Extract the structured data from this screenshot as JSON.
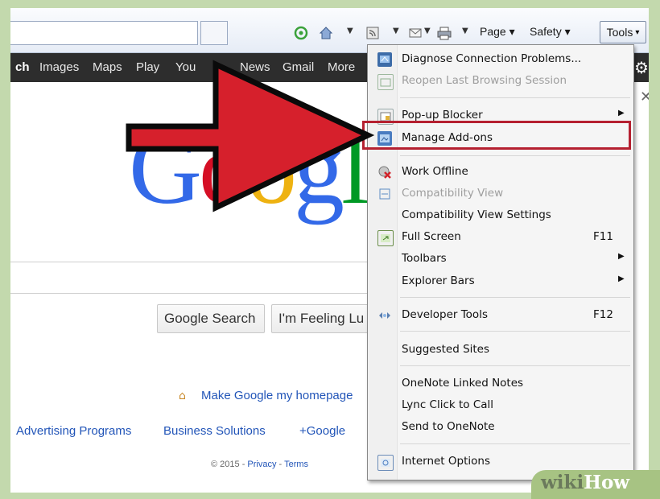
{
  "toolbar": {
    "page_label": "Page",
    "safety_label": "Safety",
    "tools_label": "Tools",
    "chevron": "»"
  },
  "google_bar": {
    "links": [
      "ch",
      "Images",
      "Maps",
      "Play",
      "You",
      "News",
      "Gmail",
      "More"
    ]
  },
  "google_logo_letters": [
    "G",
    "o",
    "o",
    "g",
    "l"
  ],
  "google_logo_colors": [
    "#3369e8",
    "#d50f25",
    "#eeb211",
    "#3369e8",
    "#009925"
  ],
  "buttons": {
    "search": "Google Search",
    "lucky": "I'm Feeling Lu"
  },
  "make_homepage": "Make Google my homepage",
  "footer_links": [
    "Advertising Programs",
    "Business Solutions",
    "+Google"
  ],
  "copyright": {
    "year": "© 2015 -",
    "privacy": "Privacy",
    "dash": "-",
    "terms": "Terms"
  },
  "menu": {
    "items": [
      {
        "label": "Diagnose Connection Problems...",
        "icon": "diagnose-icon",
        "disabled": false
      },
      {
        "label": "Reopen Last Browsing Session",
        "icon": "reopen-icon",
        "disabled": true
      },
      {
        "label": "Pop-up Blocker",
        "icon": "popup-icon",
        "submenu": true
      },
      {
        "label": "Manage Add-ons",
        "icon": "addons-icon",
        "highlighted": true
      },
      {
        "label": "Work Offline",
        "icon": "offline-icon"
      },
      {
        "label": "Compatibility View",
        "icon": "compat-icon",
        "disabled": true
      },
      {
        "label": "Compatibility View Settings"
      },
      {
        "label": "Full Screen",
        "icon": "fullscreen-icon",
        "shortcut": "F11"
      },
      {
        "label": "Toolbars",
        "submenu": true
      },
      {
        "label": "Explorer Bars",
        "submenu": true
      },
      {
        "label": "Developer Tools",
        "icon": "devtools-icon",
        "shortcut": "F12"
      },
      {
        "label": "Suggested Sites"
      },
      {
        "label": "OneNote Linked Notes"
      },
      {
        "label": "Lync Click to Call"
      },
      {
        "label": "Send to OneNote"
      },
      {
        "label": "Internet Options",
        "icon": "options-icon"
      }
    ]
  },
  "watermark": {
    "wiki": "wiki",
    "how": "How"
  },
  "colors": {
    "highlight": "#b52030",
    "arrow": "#d6202c",
    "frame": "#c3d9ad"
  }
}
